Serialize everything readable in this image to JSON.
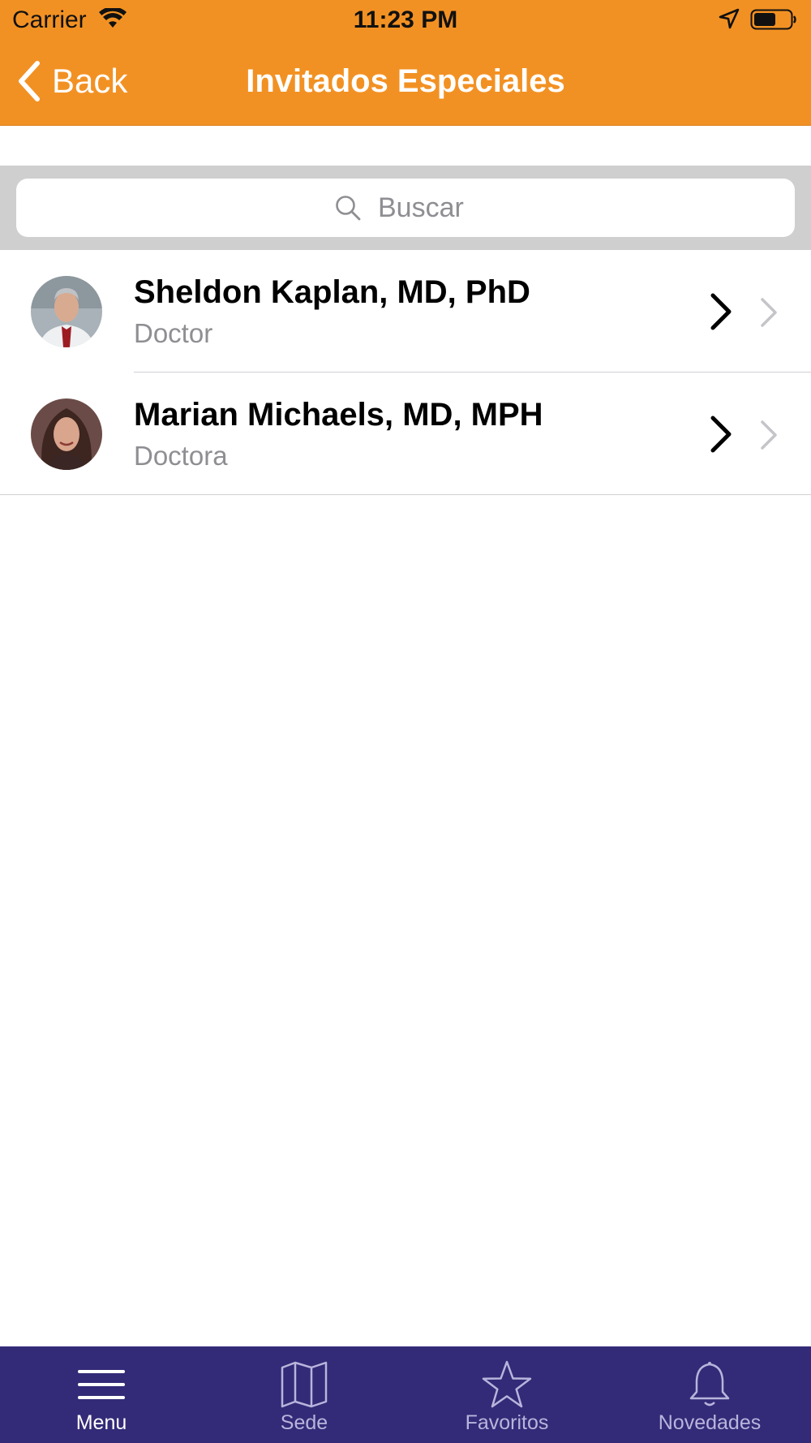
{
  "status_bar": {
    "carrier": "Carrier",
    "time": "11:23 PM"
  },
  "nav": {
    "back_label": "Back",
    "title": "Invitados Especiales"
  },
  "search": {
    "placeholder": "Buscar"
  },
  "guests": [
    {
      "name": "Sheldon Kaplan, MD, PhD",
      "role": "Doctor"
    },
    {
      "name": "Marian Michaels, MD, MPH",
      "role": "Doctora"
    }
  ],
  "tabs": [
    {
      "label": "Menu",
      "icon": "menu-icon",
      "active": true
    },
    {
      "label": "Sede",
      "icon": "map-icon",
      "active": false
    },
    {
      "label": "Favoritos",
      "icon": "star-icon",
      "active": false
    },
    {
      "label": "Novedades",
      "icon": "bell-icon",
      "active": false
    }
  ],
  "colors": {
    "nav_bar": "#f29123",
    "tab_bar": "#332b77",
    "tab_inactive": "#b9b4dc",
    "tab_active": "#ffffff"
  }
}
